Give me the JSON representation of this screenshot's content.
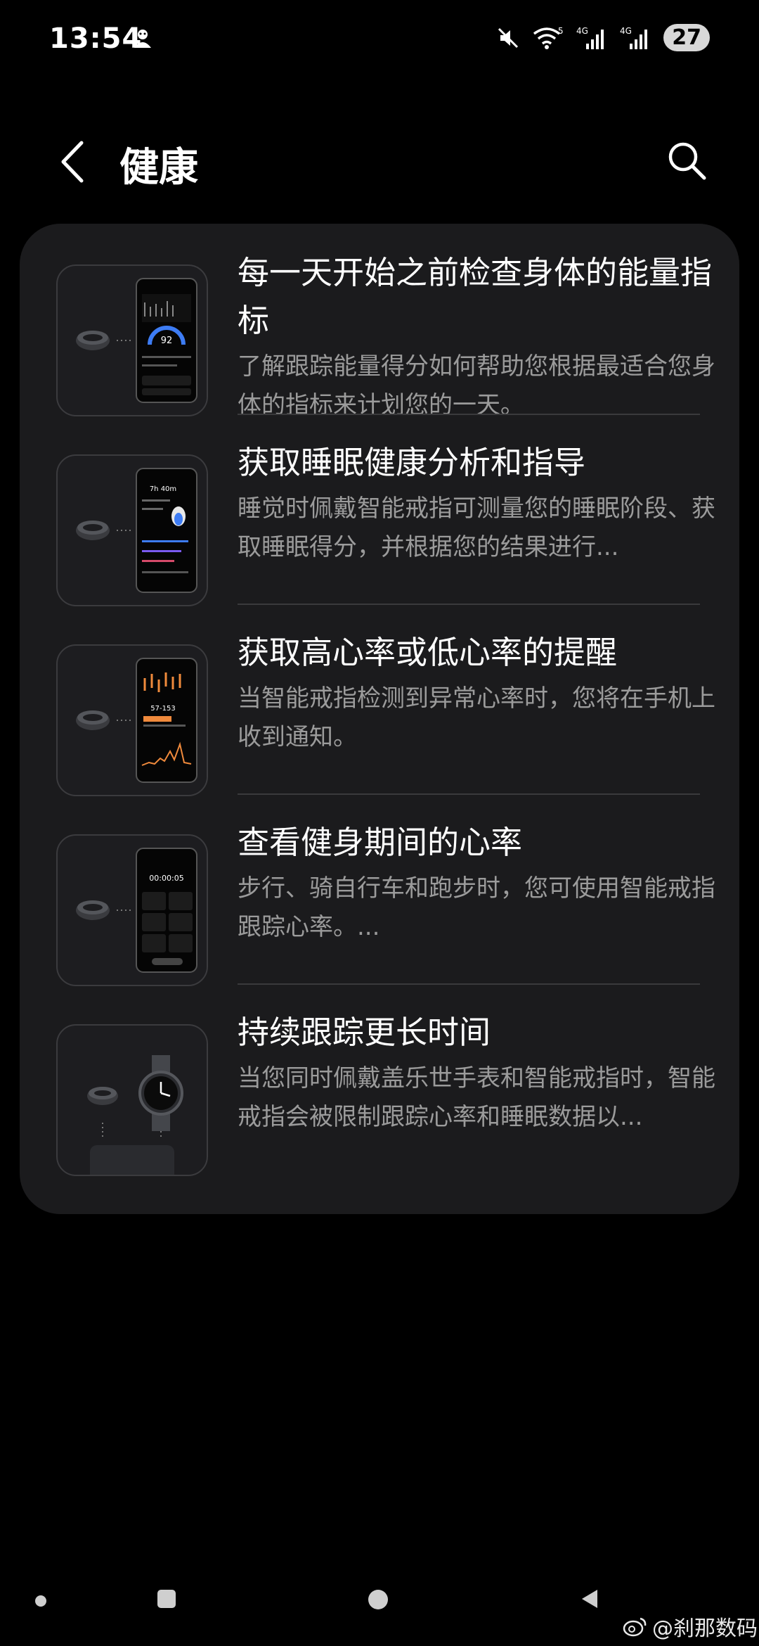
{
  "status_bar": {
    "time": "13:54",
    "network_5": "5",
    "network_4g_1": "4G",
    "network_4g_2": "4G",
    "battery": "27"
  },
  "header": {
    "title": "健康"
  },
  "items": [
    {
      "title": "每一天开始之前检查身体的能量指标",
      "desc": "了解跟踪能量得分如何帮助您根据最适合您身体的指标来计划您的一天。",
      "thumb_value": "92"
    },
    {
      "title": "获取睡眠健康分析和指导",
      "desc": "睡觉时佩戴智能戒指可测量您的睡眠阶段、获取睡眠得分，并根据您的结果进行...",
      "thumb_value": "7h 40m"
    },
    {
      "title": "获取高心率或低心率的提醒",
      "desc": "当智能戒指检测到异常心率时，您将在手机上收到通知。",
      "thumb_value": "57-153"
    },
    {
      "title": "查看健身期间的心率",
      "desc": "步行、骑自行车和跑步时，您可使用智能戒指跟踪心率。...",
      "thumb_value": "00:00:05"
    },
    {
      "title": "持续跟踪更长时间",
      "desc": "当您同时佩戴盖乐世手表和智能戒指时，智能戒指会被限制跟踪心率和睡眠数据以..."
    }
  ],
  "watermark": "@刹那数码",
  "colors": {
    "background": "#000000",
    "card": "#1b1b1d",
    "title_text": "#ffffff",
    "desc_text": "#9b9b9b",
    "accent_blue": "#3d7cf4",
    "accent_orange": "#f08a3c"
  }
}
